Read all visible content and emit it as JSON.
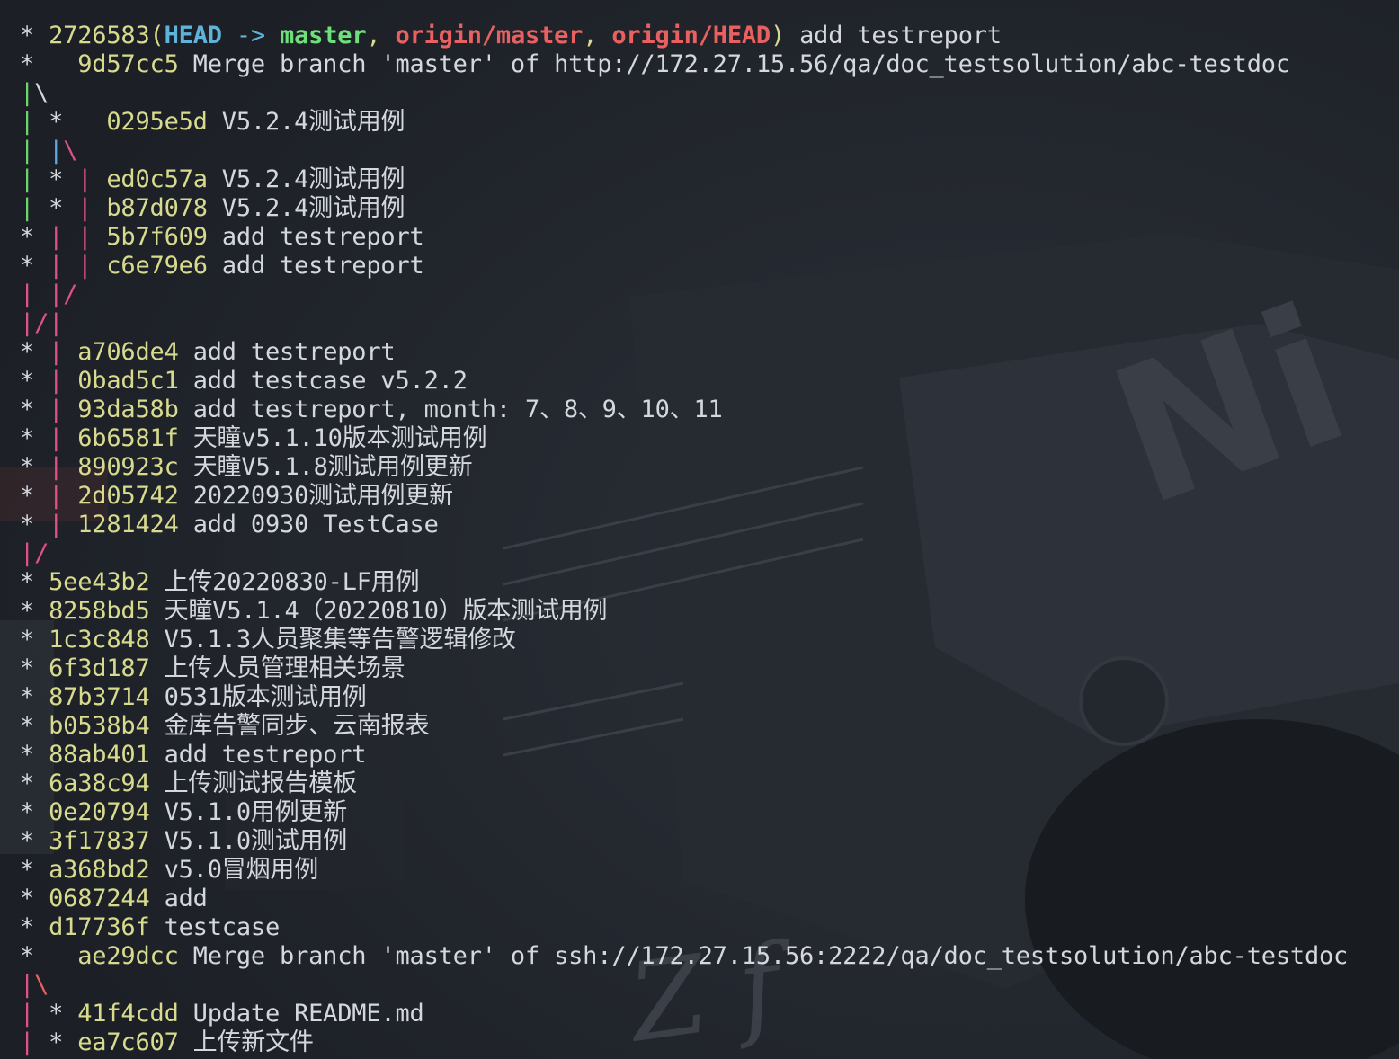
{
  "terminal": {
    "lines": [
      {
        "graph": [
          {
            "t": "* ",
            "c": "c-star"
          }
        ],
        "hash": "2726583",
        "refs": {
          "open": "(",
          "head": "HEAD",
          "arrow": " -> ",
          "branch": "master",
          "sep1": ", ",
          "origin1": "origin/master",
          "sep2": ", ",
          "origin2": "origin/HEAD",
          "close": ")"
        },
        "msg": " add testreport"
      },
      {
        "graph": [
          {
            "t": "*   ",
            "c": "c-star"
          }
        ],
        "hash": "9d57cc5",
        "msg": " Merge branch 'master' of http://172.27.15.56/qa/doc_testsolution/abc-testdoc"
      },
      {
        "graph": [
          {
            "t": "|",
            "c": "g-green"
          },
          {
            "t": "\\",
            "c": "c-star"
          }
        ],
        "hash": "",
        "msg": ""
      },
      {
        "graph": [
          {
            "t": "|",
            "c": "g-green"
          },
          {
            "t": " *   ",
            "c": "c-star"
          }
        ],
        "hash": "0295e5d",
        "msg": " V5.2.4测试用例"
      },
      {
        "graph": [
          {
            "t": "|",
            "c": "g-green"
          },
          {
            "t": " ",
            "c": "c-star"
          },
          {
            "t": "|",
            "c": "g-blue"
          },
          {
            "t": "\\",
            "c": "g-pink"
          }
        ],
        "hash": "",
        "msg": ""
      },
      {
        "graph": [
          {
            "t": "|",
            "c": "g-green"
          },
          {
            "t": " * ",
            "c": "c-star"
          },
          {
            "t": "|",
            "c": "g-pink"
          },
          {
            "t": " ",
            "c": "c-star"
          }
        ],
        "hash": "ed0c57a",
        "msg": " V5.2.4测试用例"
      },
      {
        "graph": [
          {
            "t": "|",
            "c": "g-green"
          },
          {
            "t": " * ",
            "c": "c-star"
          },
          {
            "t": "|",
            "c": "g-pink"
          },
          {
            "t": " ",
            "c": "c-star"
          }
        ],
        "hash": "b87d078",
        "msg": " V5.2.4测试用例"
      },
      {
        "graph": [
          {
            "t": "* ",
            "c": "c-star"
          },
          {
            "t": "|",
            "c": "g-pink"
          },
          {
            "t": " ",
            "c": "c-star"
          },
          {
            "t": "|",
            "c": "g-pink"
          },
          {
            "t": " ",
            "c": "c-star"
          }
        ],
        "hash": "5b7f609",
        "msg": " add testreport"
      },
      {
        "graph": [
          {
            "t": "* ",
            "c": "c-star"
          },
          {
            "t": "|",
            "c": "g-pink"
          },
          {
            "t": " ",
            "c": "c-star"
          },
          {
            "t": "|",
            "c": "g-pink"
          },
          {
            "t": " ",
            "c": "c-star"
          }
        ],
        "hash": "c6e79e6",
        "msg": " add testreport"
      },
      {
        "graph": [
          {
            "t": "| ",
            "c": "g-pink"
          },
          {
            "t": "|",
            "c": "g-pink"
          },
          {
            "t": "/",
            "c": "g-pink"
          }
        ],
        "hash": "",
        "msg": ""
      },
      {
        "graph": [
          {
            "t": "|",
            "c": "g-pink"
          },
          {
            "t": "/",
            "c": "g-pink"
          },
          {
            "t": "|",
            "c": "g-pink"
          }
        ],
        "hash": "",
        "msg": ""
      },
      {
        "graph": [
          {
            "t": "* ",
            "c": "c-star"
          },
          {
            "t": "|",
            "c": "g-pink"
          },
          {
            "t": " ",
            "c": "c-star"
          }
        ],
        "hash": "a706de4",
        "msg": " add testreport"
      },
      {
        "graph": [
          {
            "t": "* ",
            "c": "c-star"
          },
          {
            "t": "|",
            "c": "g-pink"
          },
          {
            "t": " ",
            "c": "c-star"
          }
        ],
        "hash": "0bad5c1",
        "msg": " add testcase v5.2.2"
      },
      {
        "graph": [
          {
            "t": "* ",
            "c": "c-star"
          },
          {
            "t": "|",
            "c": "g-pink"
          },
          {
            "t": " ",
            "c": "c-star"
          }
        ],
        "hash": "93da58b",
        "msg": " add testreport, month: 7、8、9、10、11"
      },
      {
        "graph": [
          {
            "t": "* ",
            "c": "c-star"
          },
          {
            "t": "|",
            "c": "g-pink"
          },
          {
            "t": " ",
            "c": "c-star"
          }
        ],
        "hash": "6b6581f",
        "msg": " 天瞳v5.1.10版本测试用例"
      },
      {
        "graph": [
          {
            "t": "* ",
            "c": "c-star"
          },
          {
            "t": "|",
            "c": "g-pink"
          },
          {
            "t": " ",
            "c": "c-star"
          }
        ],
        "hash": "890923c",
        "msg": " 天瞳V5.1.8测试用例更新"
      },
      {
        "graph": [
          {
            "t": "* ",
            "c": "c-star"
          },
          {
            "t": "|",
            "c": "g-pink"
          },
          {
            "t": " ",
            "c": "c-star"
          }
        ],
        "hash": "2d05742",
        "msg": " 20220930测试用例更新"
      },
      {
        "graph": [
          {
            "t": "* ",
            "c": "c-star"
          },
          {
            "t": "|",
            "c": "g-pink"
          },
          {
            "t": " ",
            "c": "c-star"
          }
        ],
        "hash": "1281424",
        "msg": " add 0930 TestCase"
      },
      {
        "graph": [
          {
            "t": "|",
            "c": "g-pink"
          },
          {
            "t": "/",
            "c": "g-pink"
          }
        ],
        "hash": "",
        "msg": ""
      },
      {
        "graph": [
          {
            "t": "* ",
            "c": "c-star"
          }
        ],
        "hash": "5ee43b2",
        "msg": " 上传20220830-LF用例"
      },
      {
        "graph": [
          {
            "t": "* ",
            "c": "c-star"
          }
        ],
        "hash": "8258bd5",
        "msg": " 天瞳V5.1.4（20220810）版本测试用例"
      },
      {
        "graph": [
          {
            "t": "* ",
            "c": "c-star"
          }
        ],
        "hash": "1c3c848",
        "msg": " V5.1.3人员聚集等告警逻辑修改"
      },
      {
        "graph": [
          {
            "t": "* ",
            "c": "c-star"
          }
        ],
        "hash": "6f3d187",
        "msg": " 上传人员管理相关场景"
      },
      {
        "graph": [
          {
            "t": "* ",
            "c": "c-star"
          }
        ],
        "hash": "87b3714",
        "msg": " 0531版本测试用例"
      },
      {
        "graph": [
          {
            "t": "* ",
            "c": "c-star"
          }
        ],
        "hash": "b0538b4",
        "msg": " 金库告警同步、云南报表"
      },
      {
        "graph": [
          {
            "t": "* ",
            "c": "c-star"
          }
        ],
        "hash": "88ab401",
        "msg": " add testreport"
      },
      {
        "graph": [
          {
            "t": "* ",
            "c": "c-star"
          }
        ],
        "hash": "6a38c94",
        "msg": " 上传测试报告模板"
      },
      {
        "graph": [
          {
            "t": "* ",
            "c": "c-star"
          }
        ],
        "hash": "0e20794",
        "msg": " V5.1.0用例更新"
      },
      {
        "graph": [
          {
            "t": "* ",
            "c": "c-star"
          }
        ],
        "hash": "3f17837",
        "msg": " V5.1.0测试用例"
      },
      {
        "graph": [
          {
            "t": "* ",
            "c": "c-star"
          }
        ],
        "hash": "a368bd2",
        "msg": " v5.0冒烟用例"
      },
      {
        "graph": [
          {
            "t": "* ",
            "c": "c-star"
          }
        ],
        "hash": "0687244",
        "msg": " add"
      },
      {
        "graph": [
          {
            "t": "* ",
            "c": "c-star"
          }
        ],
        "hash": "d17736f",
        "msg": " testcase"
      },
      {
        "graph": [
          {
            "t": "*   ",
            "c": "c-star"
          }
        ],
        "hash": "ae29dcc",
        "msg": " Merge branch 'master' of ssh://172.27.15.56:2222/qa/doc_testsolution/abc-testdoc"
      },
      {
        "graph": [
          {
            "t": "|",
            "c": "g-pink"
          },
          {
            "t": "\\",
            "c": "g-red"
          }
        ],
        "hash": "",
        "msg": ""
      },
      {
        "graph": [
          {
            "t": "|",
            "c": "g-pink"
          },
          {
            "t": " * ",
            "c": "c-star"
          }
        ],
        "hash": "41f4cdd",
        "msg": " Update README.md"
      },
      {
        "graph": [
          {
            "t": "|",
            "c": "g-pink"
          },
          {
            "t": " * ",
            "c": "c-star"
          }
        ],
        "hash": "ea7c607",
        "msg": " 上传新文件"
      }
    ]
  },
  "background": {
    "watermark_text": "Ni",
    "wallpaper_text": "Z f"
  }
}
